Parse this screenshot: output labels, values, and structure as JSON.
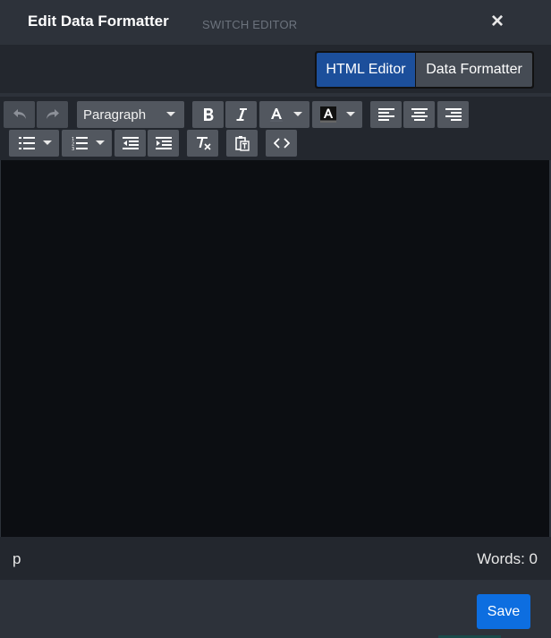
{
  "dialog": {
    "title": "Edit Data Formatter",
    "close_symbol": "×"
  },
  "switch_editor": {
    "label": "SWITCH EDITOR",
    "options": [
      "HTML Editor",
      "Data Formatter"
    ],
    "selected": "HTML Editor"
  },
  "toolbar": {
    "format_select": "Paragraph",
    "icons": [
      "undo-icon",
      "redo-icon",
      "bold-icon",
      "italic-icon",
      "text-color-icon",
      "background-color-icon",
      "align-left-icon",
      "align-center-icon",
      "align-right-icon",
      "bullet-list-icon",
      "numbered-list-icon",
      "outdent-icon",
      "indent-icon",
      "clear-formatting-icon",
      "paste-text-icon",
      "source-code-icon"
    ]
  },
  "statusbar": {
    "path": "p",
    "word_count": "Words: 0"
  },
  "footer": {
    "save_label": "Save"
  },
  "colors": {
    "accent": "#0d6ee0",
    "selected_tab": "#1c4f9b",
    "editor_bg": "#0c0e12"
  }
}
